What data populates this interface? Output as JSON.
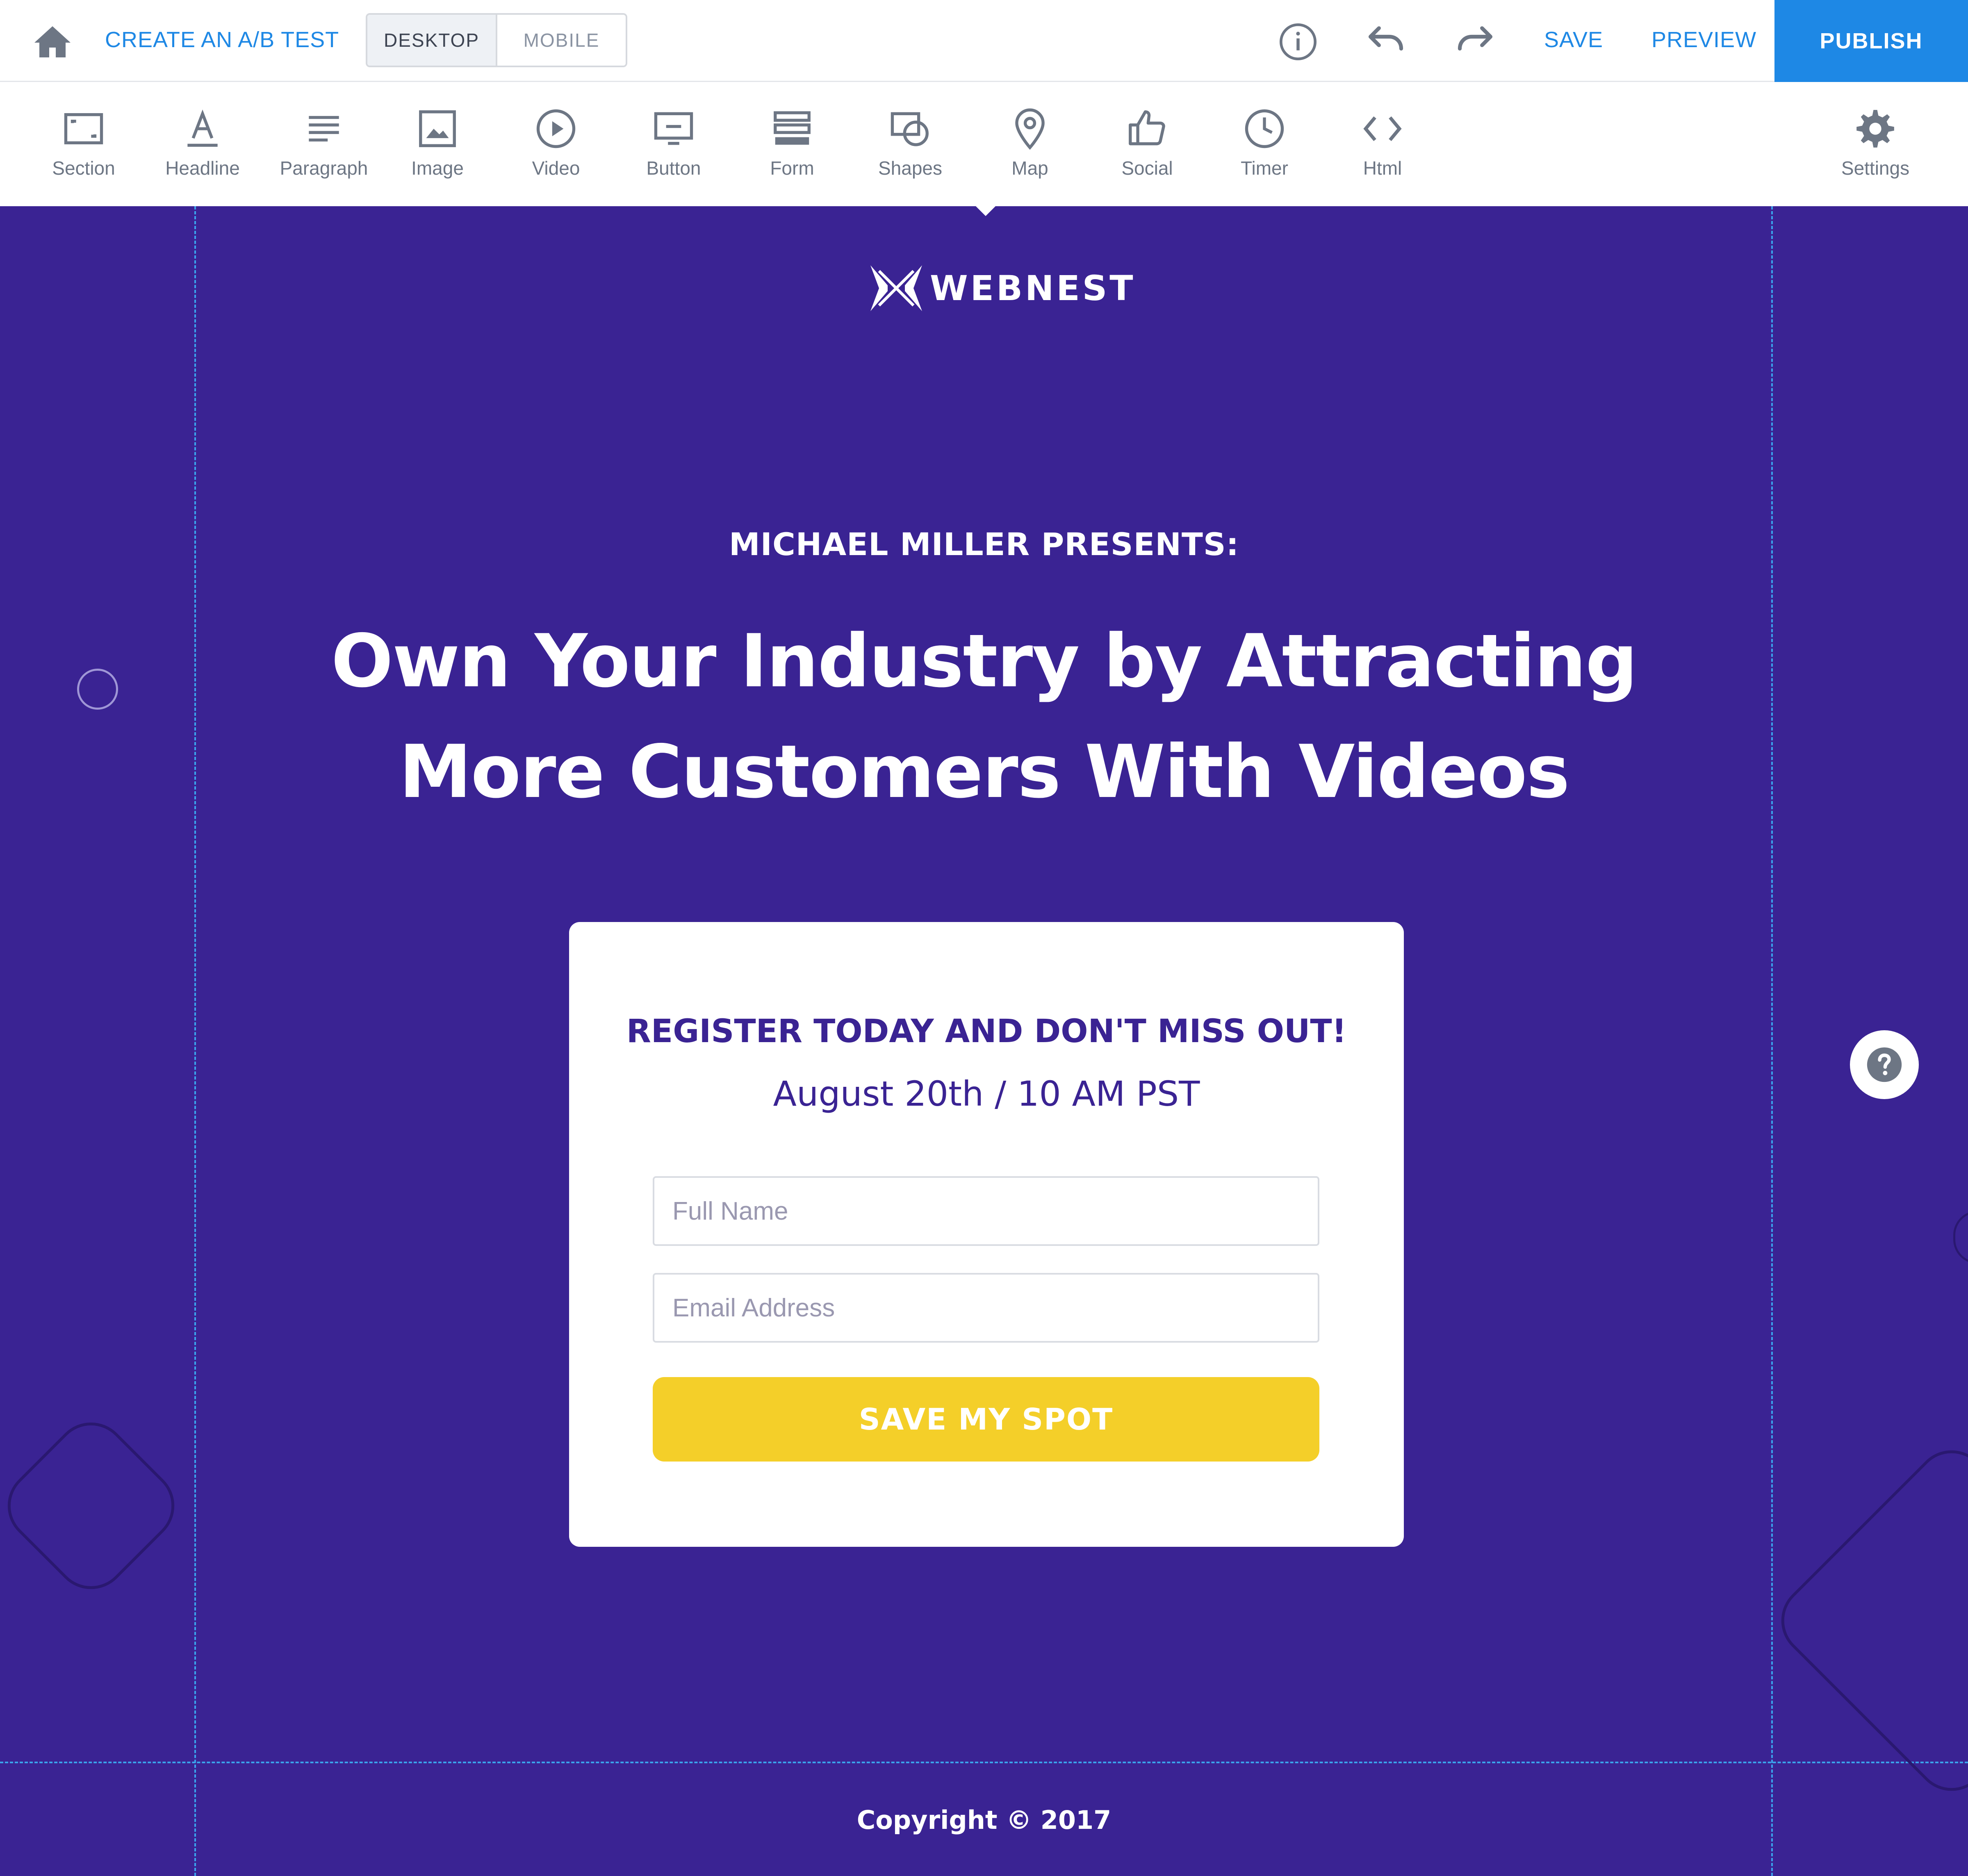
{
  "topbar": {
    "ab_test": "CREATE AN A/B TEST",
    "desktop": "DESKTOP",
    "mobile": "MOBILE",
    "save": "SAVE",
    "preview": "PREVIEW",
    "publish": "PUBLISH"
  },
  "toolbar": {
    "items": [
      {
        "label": "Section",
        "icon": "section-icon"
      },
      {
        "label": "Headline",
        "icon": "headline-icon"
      },
      {
        "label": "Paragraph",
        "icon": "paragraph-icon"
      },
      {
        "label": "Image",
        "icon": "image-icon"
      },
      {
        "label": "Video",
        "icon": "video-icon"
      },
      {
        "label": "Button",
        "icon": "button-icon"
      },
      {
        "label": "Form",
        "icon": "form-icon"
      },
      {
        "label": "Shapes",
        "icon": "shapes-icon"
      },
      {
        "label": "Map",
        "icon": "map-pin-icon"
      },
      {
        "label": "Social",
        "icon": "thumbs-up-icon"
      },
      {
        "label": "Timer",
        "icon": "clock-icon"
      },
      {
        "label": "Html",
        "icon": "code-icon"
      }
    ],
    "settings": "Settings"
  },
  "page": {
    "logo_text": "WEBNEST",
    "presents": "MICHAEL MILLER PRESENTS:",
    "headline_line1": "Own Your Industry by Attracting",
    "headline_line2": "More Customers With Videos",
    "card": {
      "title": "REGISTER TODAY AND DON'T MISS OUT!",
      "date": "August 20th / 10 AM PST",
      "name_placeholder": "Full Name",
      "email_placeholder": "Email Address",
      "cta": "SAVE MY SPOT"
    },
    "copyright": "Copyright © 2017"
  },
  "colors": {
    "accent": "#1e88e5",
    "canvas_bg": "#3a2393",
    "cta": "#f4cf29",
    "guide": "#3aa3ec"
  }
}
